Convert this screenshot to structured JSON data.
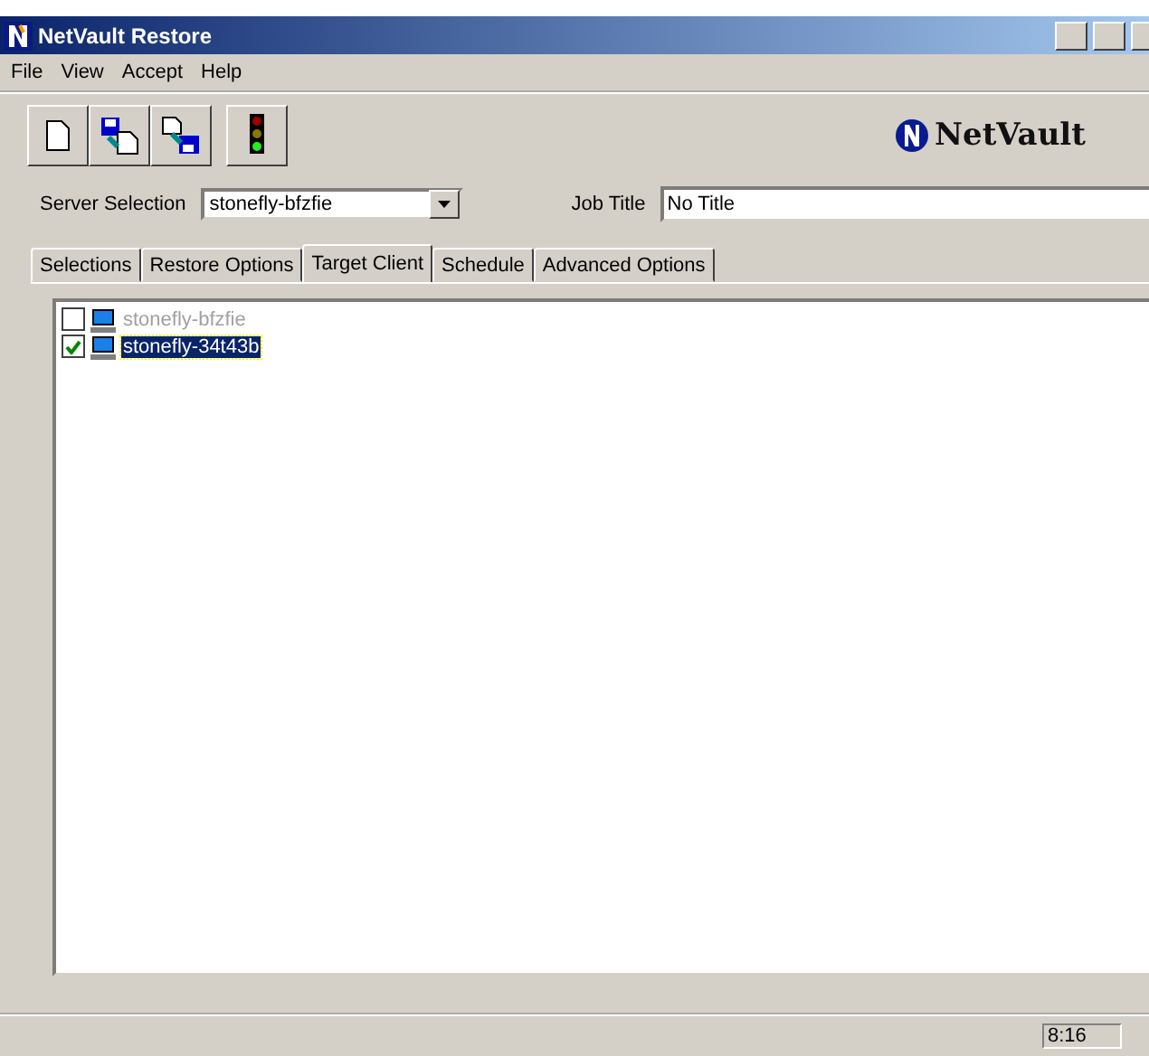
{
  "window": {
    "title": "NetVault Restore"
  },
  "menu": [
    "File",
    "View",
    "Accept",
    "Help"
  ],
  "logo": {
    "text": "NetVault"
  },
  "server_selection": {
    "label": "Server Selection",
    "value": "stonefly-bfzfie"
  },
  "job_title": {
    "label": "Job Title",
    "value": "No Title"
  },
  "tabs": [
    {
      "label": "Selections",
      "selected": false
    },
    {
      "label": "Restore Options",
      "selected": false
    },
    {
      "label": "Target Client",
      "selected": true
    },
    {
      "label": "Schedule",
      "selected": false
    },
    {
      "label": "Advanced Options",
      "selected": false
    }
  ],
  "clients": [
    {
      "name": "stonefly-bfzfie",
      "checked": false,
      "selected": false,
      "disabled": true
    },
    {
      "name": "stonefly-34t43b",
      "checked": true,
      "selected": true,
      "disabled": false
    }
  ],
  "status_bar": {
    "time": "8:16"
  }
}
